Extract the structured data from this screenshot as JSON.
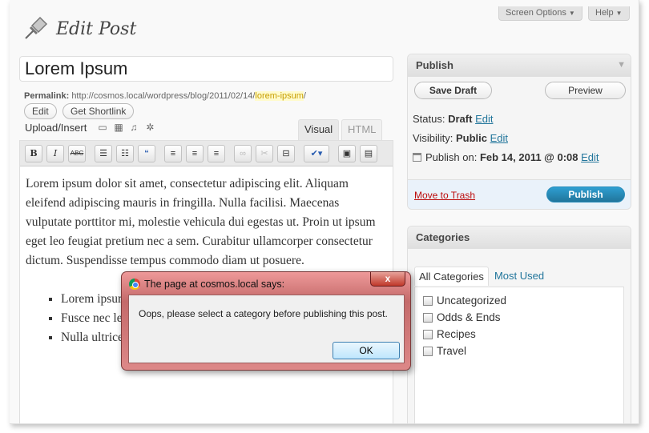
{
  "header": {
    "screen_options": "Screen Options",
    "help": "Help",
    "page_title": "Edit Post"
  },
  "post": {
    "title_value": "Lorem Ipsum",
    "permalink_label": "Permalink:",
    "permalink_base": "http://cosmos.local/wordpress/blog/2011/02/14/",
    "permalink_slug": "lorem-ipsum",
    "permalink_trail": "/",
    "edit_label": "Edit",
    "shortlink_label": "Get Shortlink",
    "upload_label": "Upload/Insert"
  },
  "editor": {
    "tab_visual": "Visual",
    "tab_html": "HTML",
    "paragraph": "Lorem ipsum dolor sit amet, consectetur adipiscing elit. Aliquam eleifend adipiscing mauris in fringilla. Nulla facilisi. Maecenas vulputate porttitor mi, molestie vehicula dui egestas ut. Proin ut ipsum eget leo feugiat pretium nec a sem. Curabitur ullamcorper consectetur dictum. Suspendisse tempus commodo diam ut posuere.",
    "list_items": [
      "Lorem ipsum dolor sit amet, consectetur adipiscing elit.",
      "Fusce nec leo in est tincidunt pretium nec dolor.",
      "Nulla ultrices leo sit amet nulla viverra nec pretium est suscipit."
    ]
  },
  "publish": {
    "heading": "Publish",
    "save_draft": "Save Draft",
    "preview": "Preview",
    "status_label": "Status:",
    "status_value": "Draft",
    "visibility_label": "Visibility:",
    "visibility_value": "Public",
    "publish_on_label": "Publish on:",
    "publish_on_value": "Feb 14, 2011 @ 0:08",
    "edit_link": "Edit",
    "trash": "Move to Trash",
    "publish_button": "Publish"
  },
  "categories": {
    "heading": "Categories",
    "tab_all": "All Categories",
    "tab_used": "Most Used",
    "items": [
      "Uncategorized",
      "Odds & Ends",
      "Recipes",
      "Travel"
    ]
  },
  "dialog": {
    "title": "The page at cosmos.local says:",
    "close": "x",
    "message": "Oops, please select a category before publishing this post.",
    "ok": "OK"
  }
}
